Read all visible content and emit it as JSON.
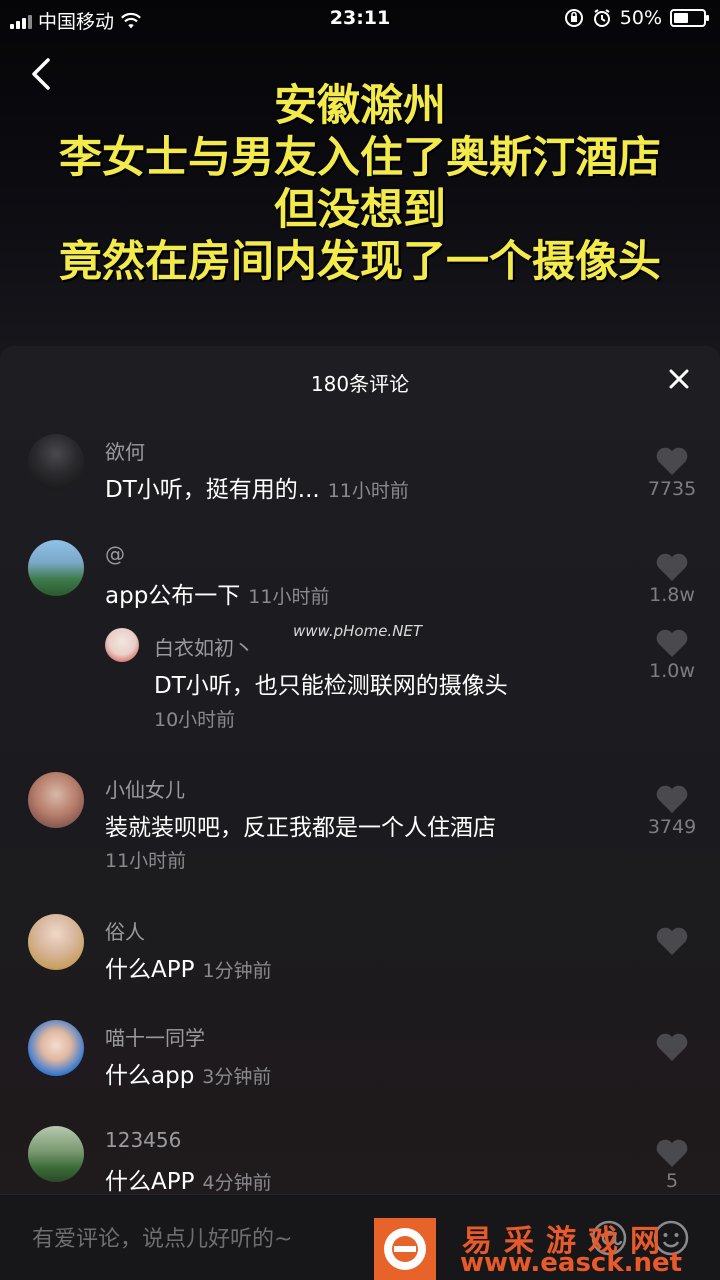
{
  "status_bar": {
    "carrier": "中国移动",
    "time": "23:11",
    "battery": "50%",
    "battery_level": 0.5
  },
  "video": {
    "headline_lines": [
      "安徽滁州",
      "李女士与男友入住了奥斯汀酒店",
      "但没想到",
      "竟然在房间内发现了一个摄像头"
    ]
  },
  "comments_panel": {
    "title": "180条评论",
    "comments": [
      {
        "user": "欲何",
        "text": "DT小听，挺有用的...",
        "time": "11小时前",
        "likes": "7735"
      },
      {
        "user": "@",
        "text": "app公布一下",
        "time": "11小时前",
        "likes": "1.8w",
        "reply": {
          "user": "白衣如初丶",
          "text": "DT小听，也只能检测联网的摄像头",
          "time": "10小时前",
          "likes": "1.0w"
        }
      },
      {
        "user": "小仙女儿",
        "text": "装就装呗吧，反正我都是一个人住酒店",
        "time": "11小时前",
        "likes": "3749"
      },
      {
        "user": "俗人",
        "text": "什么APP",
        "time": "1分钟前",
        "likes": ""
      },
      {
        "user": "喵十一同学",
        "text": "什么app",
        "time": "3分钟前",
        "likes": ""
      },
      {
        "user": "123456",
        "text": "什么APP",
        "time": "4分钟前",
        "likes": "5"
      }
    ]
  },
  "input_bar": {
    "placeholder": "有爱评论，说点儿好听的~"
  },
  "watermarks": {
    "mid": "www.pHome.NET",
    "site_name": "易采游戏网",
    "site_url": "www.easck.net"
  },
  "icons": [
    "back-icon",
    "close-icon",
    "heart-icon",
    "at-icon",
    "emoji-icon",
    "wifi-icon",
    "battery-icon"
  ]
}
